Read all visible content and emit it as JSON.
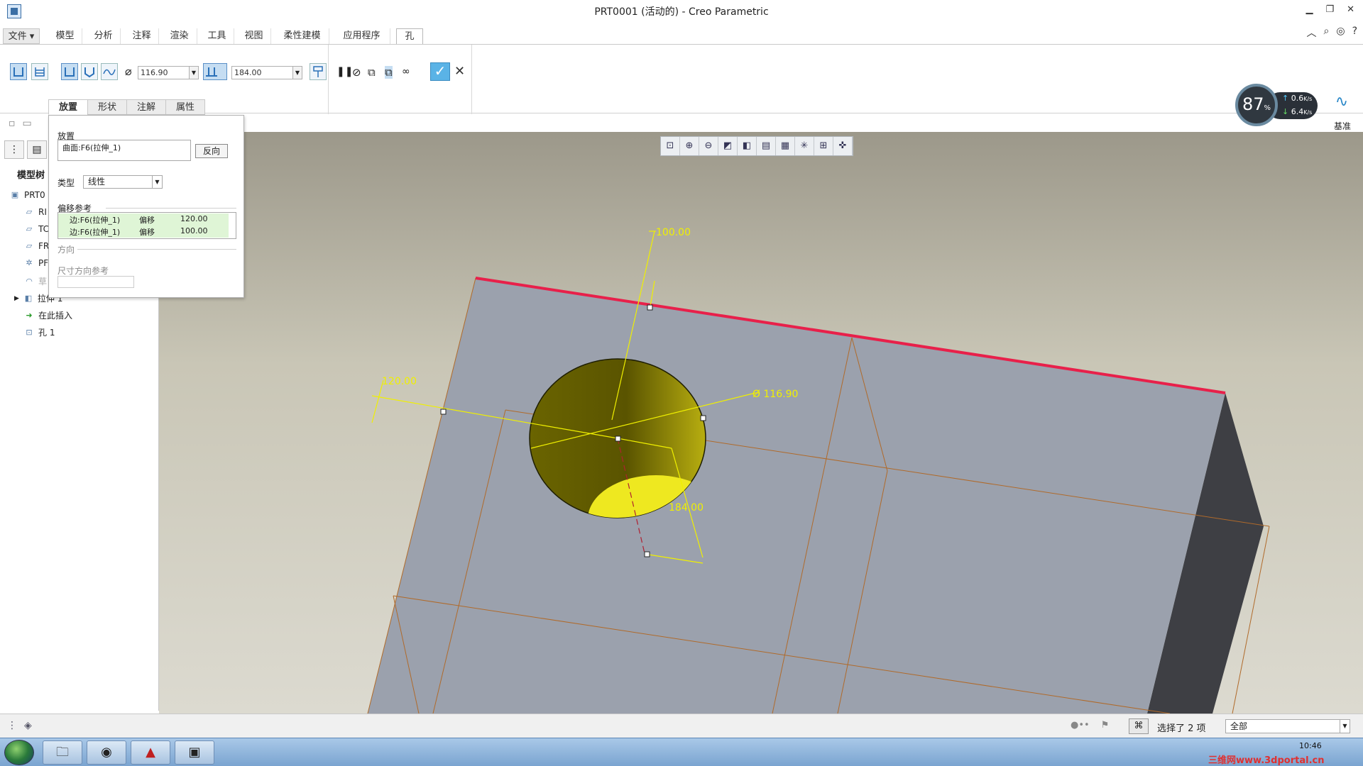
{
  "window": {
    "title": "PRT0001 (活动的) - Creo Parametric",
    "controls": [
      "minimize-icon",
      "restore-icon",
      "close-icon"
    ]
  },
  "menu": {
    "file": "文件",
    "tabs": [
      "模型",
      "分析",
      "注释",
      "渲染",
      "工具",
      "视图",
      "柔性建模",
      "应用程序"
    ],
    "active_tab": "孔"
  },
  "ribbon": {
    "diameter_value": "116.90",
    "depth_value": "184.00",
    "datum_label": "基准"
  },
  "speed_widget": {
    "percent": "87",
    "percent_unit": "%",
    "upload": "0.6",
    "download": "6.4",
    "unit": "K/s"
  },
  "subtabs": [
    "放置",
    "形状",
    "注解",
    "属性"
  ],
  "placement_panel": {
    "placement_label": "放置",
    "placement_value": "曲面:F6(拉伸_1)",
    "flip_button": "反向",
    "type_label": "类型",
    "type_value": "线性",
    "offset_refs_label": "偏移参考",
    "offset_rows": [
      {
        "ref": "边:F6(拉伸_1)",
        "kind": "偏移",
        "value": "120.00"
      },
      {
        "ref": "边:F6(拉伸_1)",
        "kind": "偏移",
        "value": "100.00"
      }
    ],
    "direction_label": "方向",
    "dim_direction_label": "尺寸方向参考"
  },
  "model_tree": {
    "title": "模型树",
    "items": [
      "PRT0",
      "RI",
      "TC",
      "FR",
      "PF",
      "草",
      "拉伸 1",
      "在此插入",
      "孔 1"
    ]
  },
  "graphics": {
    "dim_top": "100.00",
    "dim_left": "120.00",
    "dim_diameter": "Ø 116.90",
    "dim_depth": "184.00"
  },
  "statusbar": {
    "selected_text": "选择了 2 项",
    "filter_value": "全部"
  },
  "taskbar": {
    "time": "10:46",
    "watermark": "三维网www.3dportal.cn"
  },
  "colors": {
    "edge_highlight": "#e8204a",
    "hole_yellow": "#e8e020",
    "dim_yellow": "#f0f000",
    "model_face": "#9ba1ad",
    "ok_blue": "#5ab3e6"
  }
}
